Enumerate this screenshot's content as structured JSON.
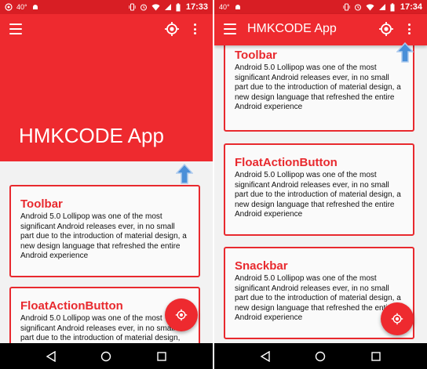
{
  "colors": {
    "status_bar": "#d81e24",
    "app_bar": "#ee2a2f",
    "accent": "#e8292e",
    "background": "#f2f2f2",
    "card_bg": "#fafafa",
    "arrow": "#4a8fd8",
    "nav_bar": "#000000"
  },
  "left": {
    "status": {
      "left_icons": [
        "whatsapp-icon",
        "temperature",
        "android-icon"
      ],
      "temperature": "40°",
      "right_icons": [
        "vibrate-icon",
        "alarm-icon",
        "wifi-icon",
        "signal-icon",
        "battery-icon"
      ],
      "time": "17:33"
    },
    "app_title": "HMKCODE App",
    "cards": [
      {
        "title": "Toolbar",
        "body": "Android 5.0 Lollipop was one of the most significant Android releases ever, in no small part due to the introduction of material design, a new design language that refreshed the entire Android experience"
      },
      {
        "title": "FloatActionButton",
        "body": "Android 5.0 Lollipop was one of the most significant Android releases ever, in no small part due to the introduction of material design,"
      }
    ]
  },
  "right": {
    "status": {
      "left_icons": [
        "temperature",
        "android-icon"
      ],
      "temperature": "40°",
      "right_icons": [
        "vibrate-icon",
        "alarm-icon",
        "wifi-icon",
        "signal-icon",
        "battery-icon"
      ],
      "time": "17:34"
    },
    "app_title": "HMKCODE App",
    "cards": [
      {
        "title": "Toolbar",
        "body": "Android 5.0 Lollipop was one of the most significant Android releases ever, in no small part due to the introduction of material design, a new design language that refreshed the entire Android experience"
      },
      {
        "title": "FloatActionButton",
        "body": "Android 5.0 Lollipop was one of the most significant Android releases ever, in no small part due to the introduction of material design, a new design language that refreshed the entire Android experience"
      },
      {
        "title": "Snackbar",
        "body": "Android 5.0 Lollipop was one of the most significant Android releases ever, in no small part due to the introduction of material design, a new design language that refreshed the entire Android experience"
      }
    ]
  },
  "nav": [
    "back-icon",
    "home-icon",
    "recents-icon"
  ]
}
